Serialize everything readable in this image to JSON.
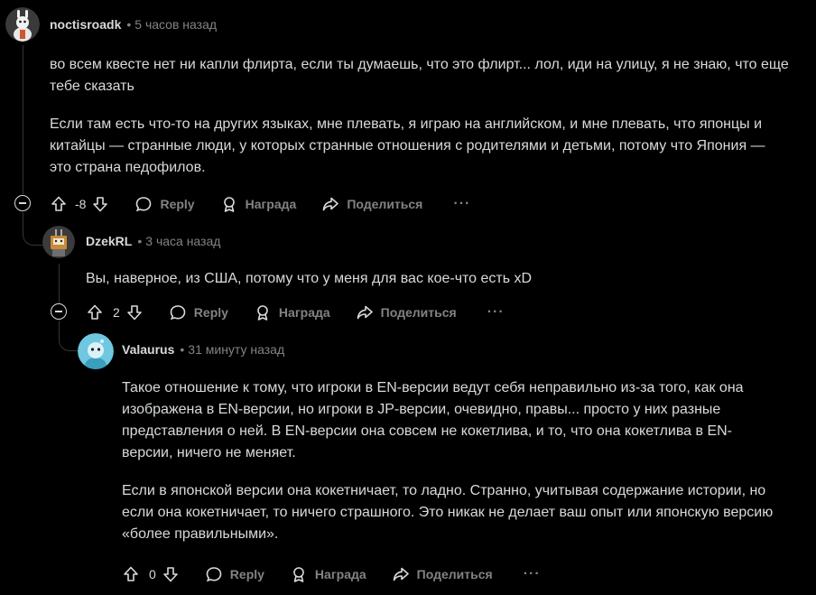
{
  "comments": [
    {
      "author": "noctisroadk",
      "time": "5 часов назад",
      "paragraphs": [
        "во всем квесте нет ни капли флирта, если ты думаешь, что это флирт... лол, иди на улицу, я не знаю, что еще тебе сказать",
        "Если там есть что-то на других языках, мне плевать, я играю на английском, и мне плевать, что японцы и китайцы — странные люди, у которых странные отношения с родителями и детьми, потому что Япония — это страна педофилов."
      ],
      "score": "-8",
      "reply_label": "Reply",
      "award_label": "Награда",
      "share_label": "Поделиться",
      "more_label": "···"
    },
    {
      "author": "DzekRL",
      "time": "3 часа назад",
      "paragraphs": [
        "Вы, наверное, из США, потому что у меня для вас кое-что есть xD"
      ],
      "score": "2",
      "reply_label": "Reply",
      "award_label": "Награда",
      "share_label": "Поделиться",
      "more_label": "···"
    },
    {
      "author": "Valaurus",
      "time": "31 минуту назад",
      "paragraphs": [
        "Такое отношение к тому, что игроки в EN-версии ведут себя неправильно из-за того, как она изображена в EN-версии, но игроки в JP-версии, очевидно, правы... просто у них разные представления о ней. В EN-версии она совсем не кокетлива, и то, что она кокетлива в EN-версии, ничего не меняет.",
        "Если в японской версии она кокетничает, то ладно. Странно, учитывая содержание истории, но если она кокетничает, то ничего страшного. Это никак не делает ваш опыт или японскую версию «более правильными»."
      ],
      "score": "0",
      "reply_label": "Reply",
      "award_label": "Награда",
      "share_label": "Поделиться",
      "more_label": "···"
    }
  ],
  "colors": {
    "background": "#000000",
    "text": "#d7dadc",
    "muted": "#818384",
    "thread_line": "#343536"
  },
  "icons": [
    "upvote-icon",
    "downvote-icon",
    "reply-icon",
    "award-icon",
    "share-icon",
    "more-icon",
    "collapse-icon"
  ]
}
